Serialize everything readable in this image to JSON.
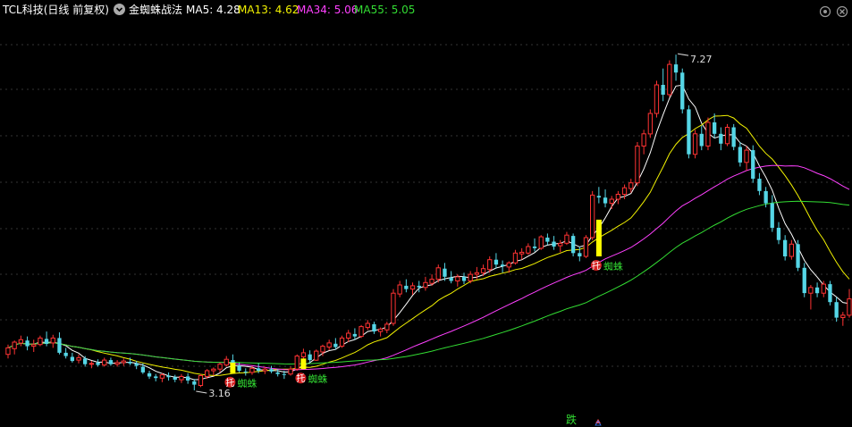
{
  "header": {
    "stock_title": "TCL科技(日线 前复权)",
    "indicator_name": "金蜘蛛战法",
    "dropdown_icon": "chevron-down-icon",
    "ma": [
      {
        "label": "MA5: 4.28",
        "color": "#ffffff"
      },
      {
        "label": "MA13: 4.62",
        "color": "#f2f200"
      },
      {
        "label": "MA34: 5.06",
        "color": "#ff40ff"
      },
      {
        "label": "MA55: 5.05",
        "color": "#33dd33"
      }
    ]
  },
  "controls": {
    "settings_icon": "gear-icon",
    "close_icon": "close-icon"
  },
  "annotations": {
    "max_label": "7.27",
    "min_label": "3.16",
    "markers": [
      {
        "badge": "托",
        "text": "蜘蛛"
      },
      {
        "badge": "托",
        "text": "蜘蛛"
      },
      {
        "badge": "托",
        "text": "蜘蛛"
      }
    ],
    "bottom_text": "跌"
  },
  "colors": {
    "up": "#ff3333",
    "down": "#55d6e6",
    "grid": "#333333",
    "signal": "#ffff00",
    "background": "#000000"
  },
  "chart_data": {
    "type": "candlestick",
    "axis_note": "sequential trading days (no dates shown), price axis unlabeled",
    "ylim": [
      2.93,
      7.72
    ],
    "candles": [
      [
        3.6,
        3.72,
        3.55,
        3.68
      ],
      [
        3.67,
        3.77,
        3.6,
        3.75
      ],
      [
        3.74,
        3.83,
        3.7,
        3.78
      ],
      [
        3.77,
        3.82,
        3.65,
        3.7
      ],
      [
        3.7,
        3.78,
        3.63,
        3.72
      ],
      [
        3.72,
        3.83,
        3.7,
        3.8
      ],
      [
        3.79,
        3.88,
        3.7,
        3.73
      ],
      [
        3.74,
        3.84,
        3.68,
        3.8
      ],
      [
        3.8,
        3.87,
        3.6,
        3.62
      ],
      [
        3.62,
        3.68,
        3.55,
        3.58
      ],
      [
        3.57,
        3.62,
        3.5,
        3.52
      ],
      [
        3.53,
        3.6,
        3.49,
        3.56
      ],
      [
        3.55,
        3.58,
        3.45,
        3.48
      ],
      [
        3.48,
        3.52,
        3.43,
        3.49
      ],
      [
        3.5,
        3.54,
        3.45,
        3.47
      ],
      [
        3.47,
        3.56,
        3.45,
        3.53
      ],
      [
        3.53,
        3.56,
        3.46,
        3.48
      ],
      [
        3.48,
        3.53,
        3.45,
        3.5
      ],
      [
        3.5,
        3.55,
        3.46,
        3.52
      ],
      [
        3.51,
        3.56,
        3.47,
        3.49
      ],
      [
        3.49,
        3.52,
        3.42,
        3.46
      ],
      [
        3.45,
        3.49,
        3.36,
        3.38
      ],
      [
        3.37,
        3.4,
        3.3,
        3.33
      ],
      [
        3.33,
        3.36,
        3.27,
        3.31
      ],
      [
        3.31,
        3.37,
        3.26,
        3.35
      ],
      [
        3.34,
        3.38,
        3.28,
        3.32
      ],
      [
        3.32,
        3.35,
        3.26,
        3.29
      ],
      [
        3.29,
        3.36,
        3.25,
        3.33
      ],
      [
        3.33,
        3.37,
        3.24,
        3.28
      ],
      [
        3.27,
        3.3,
        3.16,
        3.23
      ],
      [
        3.22,
        3.36,
        3.2,
        3.34
      ],
      [
        3.33,
        3.42,
        3.3,
        3.4
      ],
      [
        3.4,
        3.44,
        3.34,
        3.42
      ],
      [
        3.42,
        3.5,
        3.38,
        3.48
      ],
      [
        3.47,
        3.58,
        3.45,
        3.54
      ],
      [
        3.53,
        3.6,
        3.44,
        3.47
      ],
      [
        3.46,
        3.5,
        3.38,
        3.4
      ],
      [
        3.39,
        3.43,
        3.34,
        3.38
      ],
      [
        3.38,
        3.46,
        3.35,
        3.43
      ],
      [
        3.43,
        3.49,
        3.37,
        3.4
      ],
      [
        3.4,
        3.45,
        3.36,
        3.42
      ],
      [
        3.42,
        3.46,
        3.37,
        3.39
      ],
      [
        3.38,
        3.42,
        3.33,
        3.36
      ],
      [
        3.36,
        3.4,
        3.3,
        3.35
      ],
      [
        3.36,
        3.45,
        3.34,
        3.42
      ],
      [
        3.42,
        3.6,
        3.4,
        3.58
      ],
      [
        3.57,
        3.67,
        3.52,
        3.62
      ],
      [
        3.6,
        3.65,
        3.5,
        3.53
      ],
      [
        3.53,
        3.66,
        3.52,
        3.64
      ],
      [
        3.63,
        3.72,
        3.58,
        3.7
      ],
      [
        3.69,
        3.78,
        3.65,
        3.74
      ],
      [
        3.73,
        3.8,
        3.66,
        3.69
      ],
      [
        3.7,
        3.83,
        3.68,
        3.8
      ],
      [
        3.8,
        3.9,
        3.75,
        3.86
      ],
      [
        3.85,
        3.92,
        3.78,
        3.82
      ],
      [
        3.82,
        3.96,
        3.8,
        3.94
      ],
      [
        3.93,
        4.02,
        3.9,
        3.98
      ],
      [
        3.97,
        4.0,
        3.85,
        3.88
      ],
      [
        3.88,
        3.93,
        3.82,
        3.91
      ],
      [
        3.9,
        4.0,
        3.86,
        3.97
      ],
      [
        3.98,
        4.4,
        3.95,
        4.35
      ],
      [
        4.34,
        4.5,
        4.3,
        4.45
      ],
      [
        4.44,
        4.52,
        4.36,
        4.4
      ],
      [
        4.4,
        4.48,
        4.33,
        4.44
      ],
      [
        4.44,
        4.5,
        4.36,
        4.42
      ],
      [
        4.42,
        4.55,
        4.38,
        4.48
      ],
      [
        4.47,
        4.58,
        4.44,
        4.52
      ],
      [
        4.52,
        4.7,
        4.48,
        4.66
      ],
      [
        4.65,
        4.72,
        4.5,
        4.55
      ],
      [
        4.54,
        4.62,
        4.47,
        4.5
      ],
      [
        4.5,
        4.58,
        4.43,
        4.55
      ],
      [
        4.55,
        4.6,
        4.46,
        4.5
      ],
      [
        4.5,
        4.62,
        4.47,
        4.58
      ],
      [
        4.58,
        4.67,
        4.52,
        4.6
      ],
      [
        4.6,
        4.7,
        4.56,
        4.65
      ],
      [
        4.64,
        4.8,
        4.6,
        4.76
      ],
      [
        4.76,
        4.84,
        4.65,
        4.7
      ],
      [
        4.7,
        4.75,
        4.6,
        4.68
      ],
      [
        4.67,
        4.74,
        4.6,
        4.72
      ],
      [
        4.72,
        4.88,
        4.7,
        4.84
      ],
      [
        4.83,
        4.9,
        4.76,
        4.85
      ],
      [
        4.84,
        4.96,
        4.82,
        4.92
      ],
      [
        4.92,
        5.02,
        4.86,
        4.9
      ],
      [
        4.9,
        5.06,
        4.88,
        5.04
      ],
      [
        5.03,
        5.08,
        4.94,
        4.98
      ],
      [
        4.98,
        5.05,
        4.88,
        4.92
      ],
      [
        4.93,
        5.0,
        4.85,
        4.96
      ],
      [
        4.96,
        5.1,
        4.94,
        5.06
      ],
      [
        5.05,
        5.08,
        4.8,
        4.84
      ],
      [
        4.84,
        4.92,
        4.74,
        4.8
      ],
      [
        4.8,
        5.06,
        4.78,
        5.03
      ],
      [
        5.03,
        5.6,
        5.0,
        5.55
      ],
      [
        5.54,
        5.65,
        5.45,
        5.52
      ],
      [
        5.52,
        5.62,
        5.4,
        5.45
      ],
      [
        5.45,
        5.54,
        5.38,
        5.5
      ],
      [
        5.5,
        5.6,
        5.44,
        5.56
      ],
      [
        5.56,
        5.68,
        5.5,
        5.64
      ],
      [
        5.63,
        5.75,
        5.58,
        5.7
      ],
      [
        5.7,
        6.2,
        5.66,
        6.15
      ],
      [
        6.15,
        6.35,
        6.05,
        6.3
      ],
      [
        6.3,
        6.6,
        6.25,
        6.55
      ],
      [
        6.55,
        6.95,
        6.5,
        6.9
      ],
      [
        6.9,
        7.1,
        6.7,
        6.78
      ],
      [
        6.78,
        7.2,
        6.75,
        7.15
      ],
      [
        7.15,
        7.27,
        6.95,
        7.05
      ],
      [
        7.05,
        7.1,
        6.55,
        6.6
      ],
      [
        6.6,
        6.65,
        6.0,
        6.05
      ],
      [
        6.05,
        6.35,
        6.0,
        6.3
      ],
      [
        6.3,
        6.4,
        6.1,
        6.15
      ],
      [
        6.15,
        6.5,
        6.1,
        6.44
      ],
      [
        6.44,
        6.55,
        6.25,
        6.3
      ],
      [
        6.3,
        6.38,
        6.1,
        6.18
      ],
      [
        6.18,
        6.42,
        6.15,
        6.38
      ],
      [
        6.38,
        6.42,
        6.1,
        6.14
      ],
      [
        6.14,
        6.2,
        5.9,
        5.95
      ],
      [
        5.95,
        6.15,
        5.85,
        6.1
      ],
      [
        6.1,
        6.16,
        5.7,
        5.75
      ],
      [
        5.75,
        5.82,
        5.55,
        5.6
      ],
      [
        5.6,
        5.65,
        5.4,
        5.45
      ],
      [
        5.45,
        5.55,
        5.1,
        5.15
      ],
      [
        5.15,
        5.22,
        4.95,
        5.0
      ],
      [
        5.0,
        5.06,
        4.75,
        4.8
      ],
      [
        4.8,
        5.0,
        4.76,
        4.95
      ],
      [
        4.95,
        5.0,
        4.62,
        4.66
      ],
      [
        4.66,
        4.72,
        4.3,
        4.35
      ],
      [
        4.35,
        4.45,
        4.15,
        4.42
      ],
      [
        4.42,
        4.48,
        4.3,
        4.35
      ],
      [
        4.35,
        4.5,
        4.3,
        4.46
      ],
      [
        4.46,
        4.5,
        4.2,
        4.24
      ],
      [
        4.24,
        4.3,
        4.0,
        4.05
      ],
      [
        4.05,
        4.12,
        3.95,
        4.08
      ],
      [
        4.08,
        4.4,
        4.05,
        4.28
      ]
    ],
    "series": [
      {
        "name": "MA5",
        "period": 5,
        "color": "#ffffff"
      },
      {
        "name": "MA13",
        "period": 13,
        "color": "#f2f200"
      },
      {
        "name": "MA34",
        "period": 34,
        "color": "#ff40ff"
      },
      {
        "name": "MA55",
        "period": 55,
        "color": "#33dd33"
      }
    ],
    "signals": [
      {
        "index": 35,
        "low": 3.37,
        "high": 3.5
      },
      {
        "index": 46,
        "low": 3.42,
        "high": 3.55
      },
      {
        "index": 92,
        "low": 4.8,
        "high": 5.25
      }
    ],
    "max_point": {
      "index": 104,
      "value": 7.27
    },
    "min_point": {
      "index": 29,
      "value": 3.16
    }
  }
}
